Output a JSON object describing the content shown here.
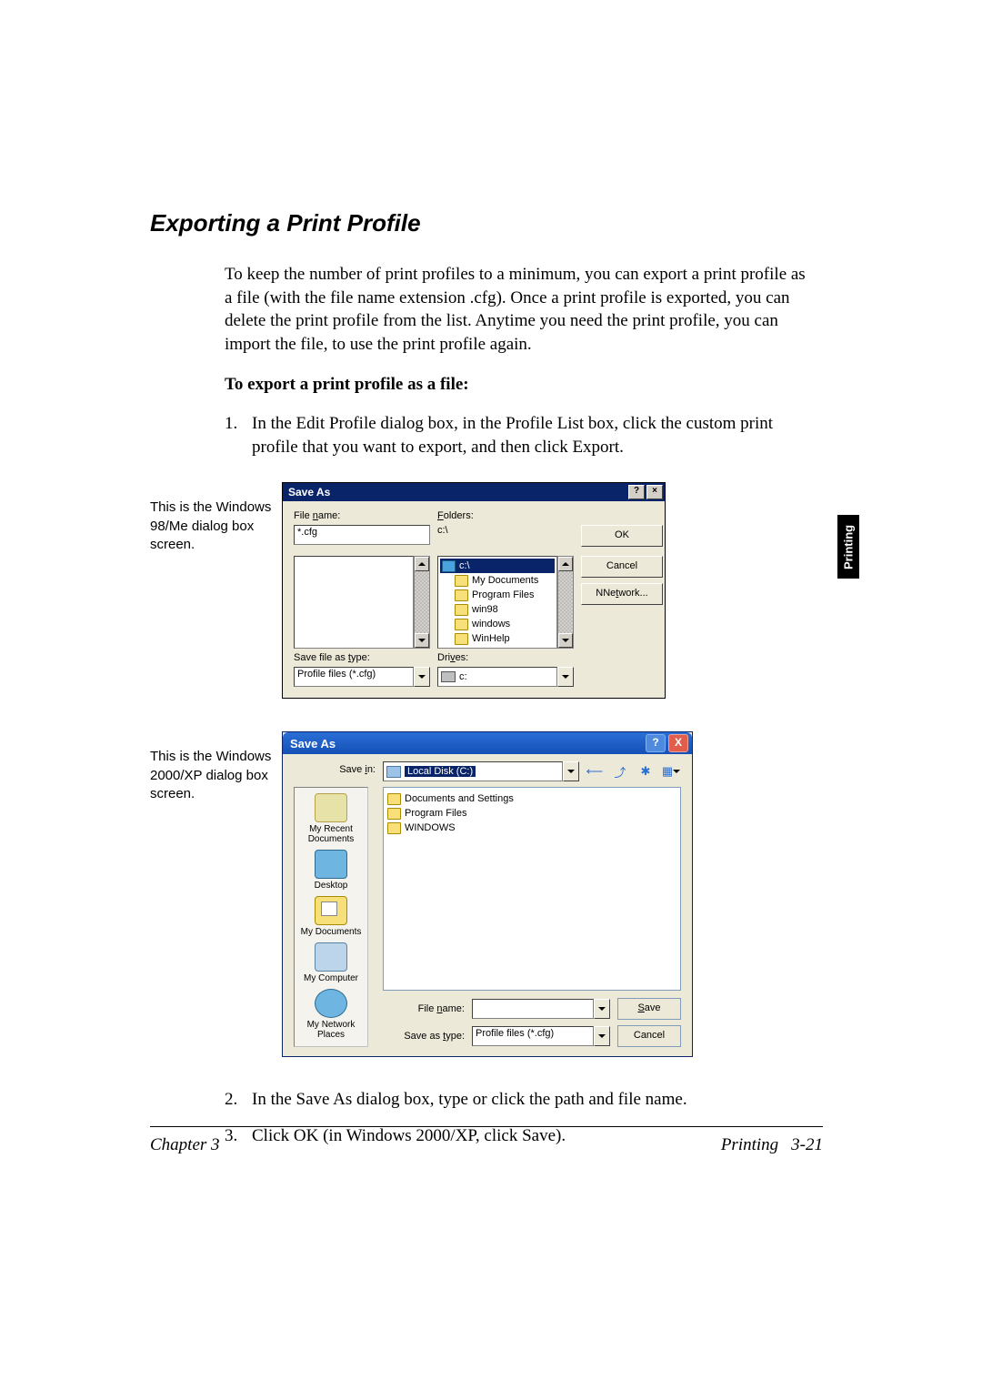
{
  "heading": "Exporting a Print Profile",
  "intro": "To keep the number of print profiles to a minimum, you can export a print profile as a file (with the file name extension .cfg). Once a print profile is exported, you can delete the print profile from the list. Anytime you need the print profile, you can import the file, to use the print profile again.",
  "bold_line": "To export a print profile as a file:",
  "step1_num": "1.",
  "step1_txt": "In the Edit Profile dialog box, in the Profile List box, click the custom print profile that you want to export, and then click Export.",
  "caption1": "This is the Windows 98/Me dialog box screen.",
  "caption2": "This is the Windows 2000/XP dialog box screen.",
  "d1": {
    "title": "Save As",
    "help": "?",
    "close": "×",
    "filename_label": "File name:",
    "filename_label_u": "n",
    "filename_value": "*.cfg",
    "folders_label": "Folders:",
    "folders_label_u": "F",
    "current_path": "c:\\",
    "ok": "OK",
    "cancel": "Cancel",
    "network": "Network...",
    "network_u": "N",
    "tree_root": "c:\\",
    "tree_items": [
      "My Documents",
      "Program Files",
      "win98",
      "windows",
      "WinHelp"
    ],
    "save_as_type_label": "Save file as type:",
    "save_as_type_label_u": "t",
    "save_as_type_value": "Profile files (*.cfg)",
    "drives_label": "Drives:",
    "drives_label_u": "v",
    "drives_value": "c:"
  },
  "d2": {
    "title": "Save As",
    "help": "?",
    "close": "X",
    "savein_label": "Save in:",
    "savein_label_u": "i",
    "savein_value": "Local Disk (C:)",
    "places": {
      "recent": "My Recent Documents",
      "desktop": "Desktop",
      "mydocs": "My Documents",
      "mycomp": "My Computer",
      "mynet": "My Network Places"
    },
    "files": [
      "Documents and Settings",
      "Program Files",
      "WINDOWS"
    ],
    "filename_label": "File name:",
    "filename_label_u": "n",
    "filename_value": "",
    "type_label": "Save as type:",
    "type_label_u": "t",
    "type_value": "Profile files (*.cfg)",
    "save": "Save",
    "save_u": "S",
    "cancel": "Cancel"
  },
  "step2_num": "2.",
  "step2_txt": "In the Save As dialog box, type or click the path and file name.",
  "step3_num": "3.",
  "step3_txt": "Click OK (in Windows 2000/XP, click Save).",
  "sidetab": "Printing",
  "footer_left": "Chapter 3",
  "footer_right_a": "Printing",
  "footer_right_b": "3-21"
}
